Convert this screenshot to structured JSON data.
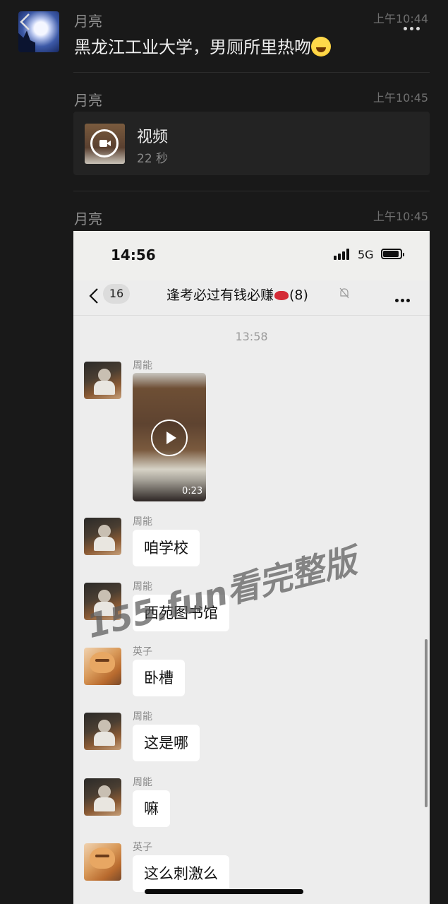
{
  "outer": {
    "messages": [
      {
        "sender": "月亮",
        "time": "上午10:44",
        "text": "黑龙江工业大学，男厕所里热吻"
      },
      {
        "sender": "月亮",
        "time": "上午10:45",
        "card_title": "视频",
        "card_duration": "22 秒"
      },
      {
        "sender": "月亮",
        "time": "上午10:45"
      }
    ]
  },
  "screenshot": {
    "status_time": "14:56",
    "network": "5G",
    "unread_count": "16",
    "group_title_prefix": "逢考必过有钱必赚",
    "group_title_count": "(8)",
    "chat_time": "13:58",
    "video_duration": "0:23",
    "messages": [
      {
        "sender": "周能",
        "type": "video"
      },
      {
        "sender": "周能",
        "text": "咱学校"
      },
      {
        "sender": "周能",
        "text": "西苑图书馆"
      },
      {
        "sender": "英子",
        "text": "卧槽"
      },
      {
        "sender": "周能",
        "text": "这是哪"
      },
      {
        "sender": "周能",
        "text": "嘛"
      },
      {
        "sender": "英子",
        "text": "这么刺激么"
      }
    ]
  },
  "watermark": "155.fun看完整版",
  "colors": {
    "background": "#191919",
    "card": "#232323",
    "chat_bg": "#ededed",
    "bubble": "#ffffff"
  }
}
